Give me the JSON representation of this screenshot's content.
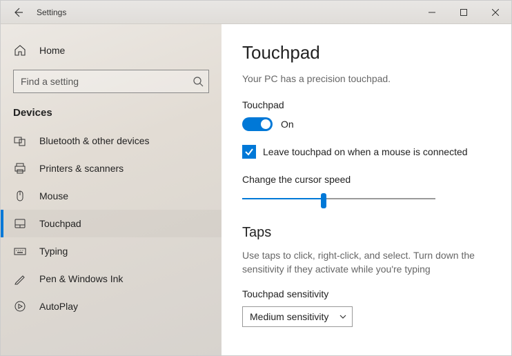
{
  "titlebar": {
    "app_title": "Settings"
  },
  "sidebar": {
    "home_label": "Home",
    "search_placeholder": "Find a setting",
    "category": "Devices",
    "items": [
      {
        "label": "Bluetooth & other devices"
      },
      {
        "label": "Printers & scanners"
      },
      {
        "label": "Mouse"
      },
      {
        "label": "Touchpad"
      },
      {
        "label": "Typing"
      },
      {
        "label": "Pen & Windows Ink"
      },
      {
        "label": "AutoPlay"
      }
    ]
  },
  "main": {
    "page_title": "Touchpad",
    "precision_msg": "Your PC has a precision touchpad.",
    "touchpad_label": "Touchpad",
    "toggle_state": "On",
    "leave_on_label": "Leave touchpad on when a mouse is connected",
    "cursor_speed_label": "Change the cursor speed",
    "taps_title": "Taps",
    "taps_desc": "Use taps to click, right-click, and select. Turn down the sensitivity if they activate while you're typing",
    "sensitivity_label": "Touchpad sensitivity",
    "sensitivity_value": "Medium sensitivity"
  }
}
